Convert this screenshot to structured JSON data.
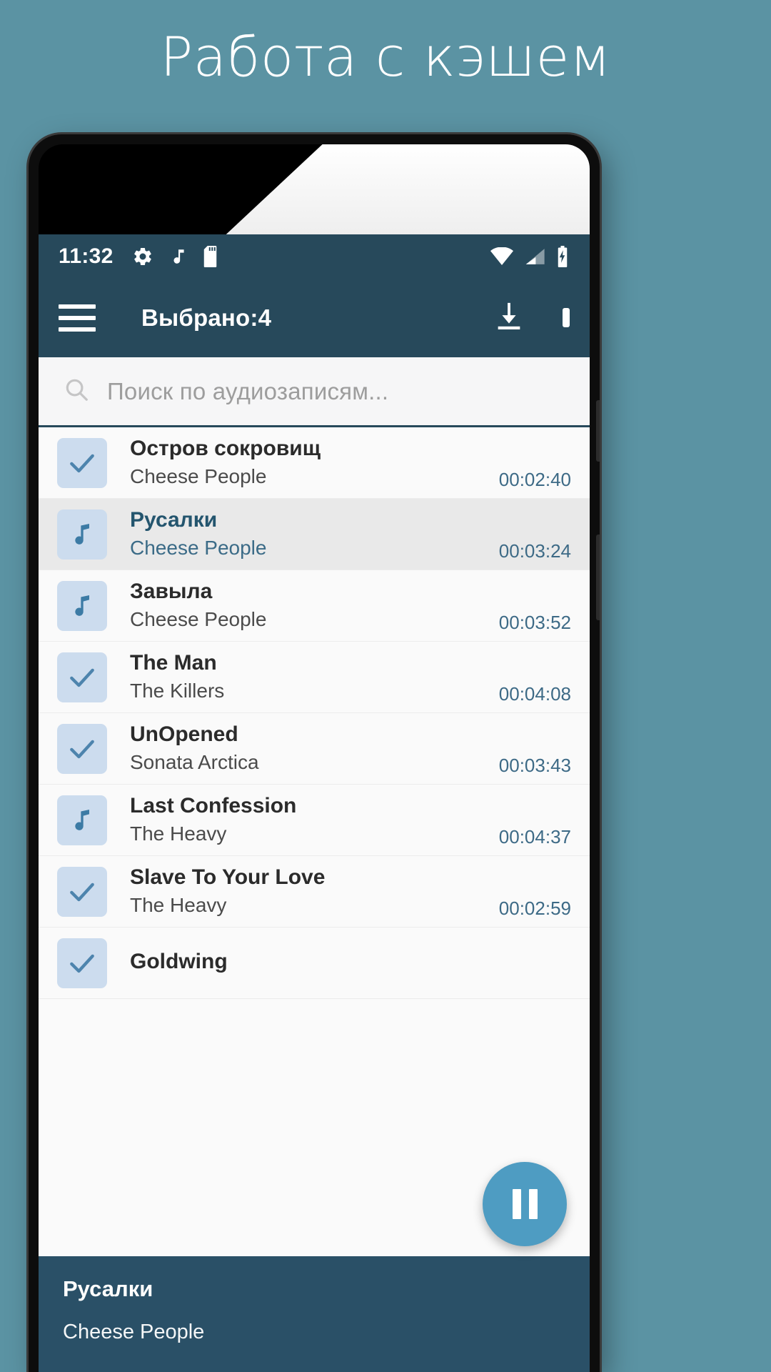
{
  "poster": {
    "title": "Работа с кэшем"
  },
  "status_bar": {
    "time": "11:32",
    "left_icons": [
      "gear-icon",
      "music-note-icon",
      "sd-card-icon"
    ],
    "right_icons": [
      "wifi-icon",
      "cellular-signal-icon",
      "battery-charging-icon"
    ]
  },
  "toolbar": {
    "menu_icon": "hamburger-menu-icon",
    "title": "Выбрано:4",
    "download_icon": "download-icon",
    "select_all_icon": "select-all-square-icon"
  },
  "search": {
    "icon": "search-icon",
    "placeholder": "Поиск по аудиозаписям...",
    "value": ""
  },
  "tracks": [
    {
      "title": "Остров сокровищ",
      "artist": "Cheese People",
      "duration": "00:02:40",
      "icon": "checkmark-icon",
      "selected": true,
      "playing": false
    },
    {
      "title": "Русалки",
      "artist": "Cheese People",
      "duration": "00:03:24",
      "icon": "music-note-icon",
      "selected": false,
      "playing": true
    },
    {
      "title": "Завыла",
      "artist": "Cheese People",
      "duration": "00:03:52",
      "icon": "music-note-icon",
      "selected": false,
      "playing": false
    },
    {
      "title": "The Man",
      "artist": "The Killers",
      "duration": "00:04:08",
      "icon": "checkmark-icon",
      "selected": true,
      "playing": false
    },
    {
      "title": "UnOpened",
      "artist": "Sonata Arctica",
      "duration": "00:03:43",
      "icon": "checkmark-icon",
      "selected": true,
      "playing": false
    },
    {
      "title": "Last Confession",
      "artist": "The Heavy",
      "duration": "00:04:37",
      "icon": "music-note-icon",
      "selected": false,
      "playing": false
    },
    {
      "title": "Slave To Your Love",
      "artist": "The Heavy",
      "duration": "00:02:59",
      "icon": "checkmark-icon",
      "selected": true,
      "playing": false
    },
    {
      "title": "Goldwing",
      "artist": "",
      "duration": "",
      "icon": "checkmark-icon",
      "selected": true,
      "playing": false
    }
  ],
  "fab": {
    "icon": "pause-icon"
  },
  "now_playing": {
    "title": "Русалки",
    "artist": "Cheese People"
  },
  "colors": {
    "poster_bg": "#5b93a3",
    "toolbar_bg": "#27495b",
    "now_playing_bg": "#2a5067",
    "fab_bg": "#4e9cc2",
    "checkbox_bg": "#ccdcee",
    "accent": "#3d6a86"
  }
}
